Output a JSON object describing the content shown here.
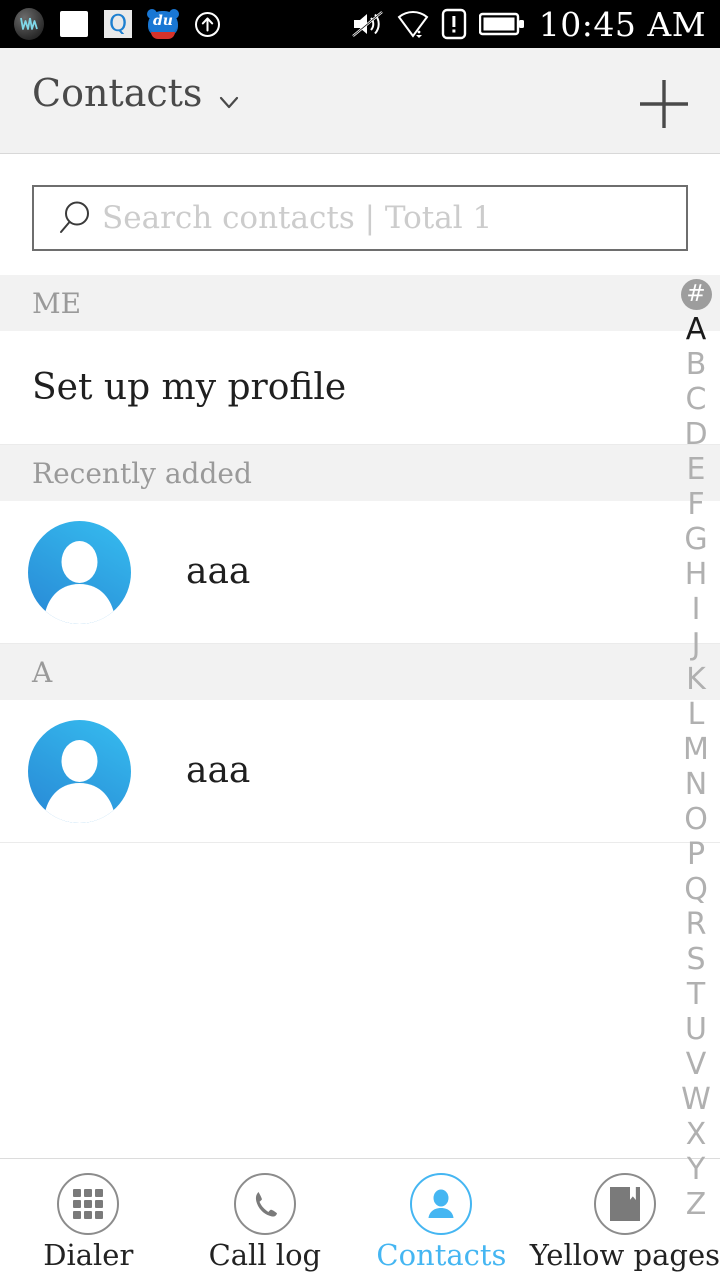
{
  "statusbar": {
    "time": "10:45 AM",
    "left_icons": [
      {
        "name": "wps-office-icon",
        "label": "WPS"
      },
      {
        "name": "gallery-icon",
        "label": "Gallery"
      },
      {
        "name": "qq-icon",
        "label": "Q"
      },
      {
        "name": "du-browser-icon",
        "label": "du"
      },
      {
        "name": "upload-arrow-icon",
        "label": "Upload"
      }
    ],
    "right_icons": [
      {
        "name": "volume-mute-icon",
        "label": "Muted"
      },
      {
        "name": "wifi-icon",
        "label": "Wi-Fi"
      },
      {
        "name": "sim-alert-icon",
        "label": "No SIM"
      },
      {
        "name": "battery-icon",
        "label": "Battery"
      }
    ]
  },
  "appbar": {
    "title": "Contacts",
    "dropdown_icon": "chevron-down-icon",
    "add_icon": "plus-icon"
  },
  "search": {
    "icon": "search-icon",
    "placeholder": "Search contacts | Total 1",
    "value": ""
  },
  "list": {
    "me_header": "ME",
    "profile_label": "Set up my profile",
    "recent_header": "Recently added",
    "recent_contacts": [
      {
        "name": "aaa",
        "avatar": "contact-avatar-icon"
      }
    ],
    "letter_header": "A",
    "letter_contacts": [
      {
        "name": "aaa",
        "avatar": "contact-avatar-icon"
      }
    ]
  },
  "index_bar": {
    "hash": "#",
    "letters": [
      "A",
      "B",
      "C",
      "D",
      "E",
      "F",
      "G",
      "H",
      "I",
      "J",
      "K",
      "L",
      "M",
      "N",
      "O",
      "P",
      "Q",
      "R",
      "S",
      "T",
      "U",
      "V",
      "W",
      "X",
      "Y",
      "Z"
    ],
    "active_letter": "A"
  },
  "bottom_nav": {
    "items": [
      {
        "label": "Dialer",
        "icon": "dialpad-icon",
        "active": false
      },
      {
        "label": "Call log",
        "icon": "phone-icon",
        "active": false
      },
      {
        "label": "Contacts",
        "icon": "person-icon",
        "active": true
      },
      {
        "label": "Yellow pages",
        "icon": "book-icon",
        "active": false
      }
    ]
  },
  "colors": {
    "accent": "#45b6f2",
    "avatar_light": "#36bdf0",
    "avatar_dark": "#2887d6",
    "section_bg": "#f2f2f2",
    "statusbar_bg": "#000000",
    "text_primary": "#1f1f1f",
    "text_muted": "#9a9a9a"
  }
}
